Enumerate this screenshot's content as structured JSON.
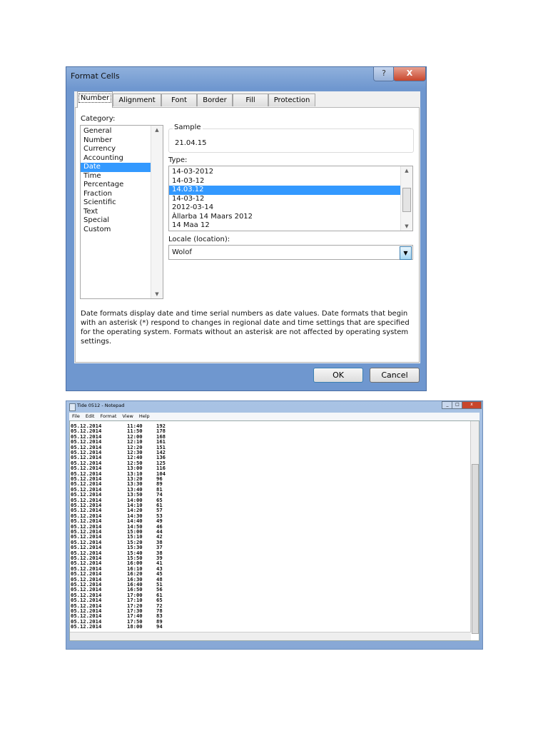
{
  "dialog": {
    "title": "Format Cells",
    "help": "?",
    "close": "X",
    "tabs": [
      "Number",
      "Alignment",
      "Font",
      "Border",
      "Fill",
      "Protection"
    ],
    "category_label": "Category:",
    "categories": [
      "General",
      "Number",
      "Currency",
      "Accounting",
      "Date",
      "Time",
      "Percentage",
      "Fraction",
      "Scientific",
      "Text",
      "Special",
      "Custom"
    ],
    "selected_category": "Date",
    "sample_label": "Sample",
    "sample_value": "21.04.15",
    "type_label": "Type:",
    "types": [
      "14-03-2012",
      "14-03-12",
      "14.03.12",
      "14-03-12",
      "2012-03-14",
      "Àllarba 14 Maars 2012",
      "14 Maa 12"
    ],
    "selected_type_index": 2,
    "locale_label": "Locale (location):",
    "locale_value": "Wolof",
    "description": "Date formats display date and time serial numbers as date values.  Date formats that begin with an asterisk (*) respond to changes in regional date and time settings that are specified for the operating system. Formats without an asterisk are not affected by operating system settings.",
    "ok": "OK",
    "cancel": "Cancel"
  },
  "notepad": {
    "title": "Tide 0512 - Notepad",
    "menu": [
      "File",
      "Edit",
      "Format",
      "View",
      "Help"
    ],
    "rows": [
      [
        "05.12.2014",
        "11:40",
        "192"
      ],
      [
        "05.12.2014",
        "11:50",
        "178"
      ],
      [
        "05.12.2014",
        "12:00",
        "168"
      ],
      [
        "05.12.2014",
        "12:10",
        "161"
      ],
      [
        "05.12.2014",
        "12:20",
        "151"
      ],
      [
        "05.12.2014",
        "12:30",
        "142"
      ],
      [
        "05.12.2014",
        "12:40",
        "136"
      ],
      [
        "05.12.2014",
        "12:50",
        "125"
      ],
      [
        "05.12.2014",
        "13:00",
        "116"
      ],
      [
        "05.12.2014",
        "13:10",
        "104"
      ],
      [
        "05.12.2014",
        "13:20",
        "96"
      ],
      [
        "05.12.2014",
        "13:30",
        "89"
      ],
      [
        "05.12.2014",
        "13:40",
        "81"
      ],
      [
        "05.12.2014",
        "13:50",
        "74"
      ],
      [
        "05.12.2014",
        "14:00",
        "65"
      ],
      [
        "05.12.2014",
        "14:10",
        "61"
      ],
      [
        "05.12.2014",
        "14:20",
        "57"
      ],
      [
        "05.12.2014",
        "14:30",
        "53"
      ],
      [
        "05.12.2014",
        "14:40",
        "49"
      ],
      [
        "05.12.2014",
        "14:50",
        "46"
      ],
      [
        "05.12.2014",
        "15:00",
        "44"
      ],
      [
        "05.12.2014",
        "15:10",
        "42"
      ],
      [
        "05.12.2014",
        "15:20",
        "38"
      ],
      [
        "05.12.2014",
        "15:30",
        "37"
      ],
      [
        "05.12.2014",
        "15:40",
        "38"
      ],
      [
        "05.12.2014",
        "15:50",
        "39"
      ],
      [
        "05.12.2014",
        "16:00",
        "41"
      ],
      [
        "05.12.2014",
        "16:10",
        "43"
      ],
      [
        "05.12.2014",
        "16:20",
        "45"
      ],
      [
        "05.12.2014",
        "16:30",
        "48"
      ],
      [
        "05.12.2014",
        "16:40",
        "51"
      ],
      [
        "05.12.2014",
        "16:50",
        "56"
      ],
      [
        "05.12.2014",
        "17:00",
        "61"
      ],
      [
        "05.12.2014",
        "17:10",
        "65"
      ],
      [
        "05.12.2014",
        "17:20",
        "72"
      ],
      [
        "05.12.2014",
        "17:30",
        "78"
      ],
      [
        "05.12.2014",
        "17:40",
        "83"
      ],
      [
        "05.12.2014",
        "17:50",
        "89"
      ],
      [
        "05.12.2014",
        "18:00",
        "94"
      ]
    ]
  }
}
